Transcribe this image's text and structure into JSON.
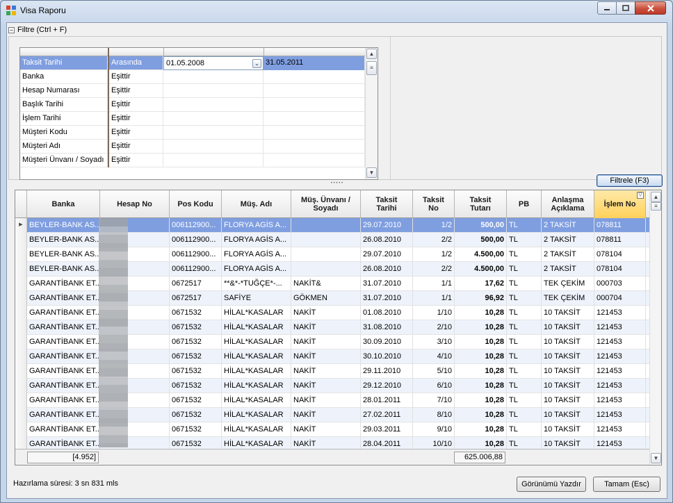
{
  "window": {
    "title": "Visa Raporu"
  },
  "filter": {
    "header": "Filtre (Ctrl + F)",
    "rows": [
      {
        "field": "Taksit Tarihi",
        "op": "Arasında",
        "v1": "01.05.2008",
        "v2": "31.05.2011"
      },
      {
        "field": "Banka",
        "op": "Eşittir",
        "v1": "",
        "v2": ""
      },
      {
        "field": "Hesap Numarası",
        "op": "Eşittir",
        "v1": "",
        "v2": ""
      },
      {
        "field": "Başlık Tarihi",
        "op": "Eşittir",
        "v1": "",
        "v2": ""
      },
      {
        "field": "İşlem Tarihi",
        "op": "Eşittir",
        "v1": "",
        "v2": ""
      },
      {
        "field": "Müşteri Kodu",
        "op": "Eşittir",
        "v1": "",
        "v2": ""
      },
      {
        "field": "Müşteri Adı",
        "op": "Eşittir",
        "v1": "",
        "v2": ""
      },
      {
        "field": "Müşteri Ünvanı / Soyadı",
        "op": "Eşittir",
        "v1": "",
        "v2": ""
      }
    ],
    "apply_button": "Filtrele (F3)"
  },
  "grid": {
    "columns": [
      {
        "label": "Banka"
      },
      {
        "label": "Hesap No"
      },
      {
        "label": "Pos Kodu"
      },
      {
        "label": "Müş. Adı"
      },
      {
        "label": "Müş. Ünvanı / Soyadı"
      },
      {
        "label": "Taksit Tarihi"
      },
      {
        "label": "Taksit No"
      },
      {
        "label": "Taksit Tutarı"
      },
      {
        "label": "PB"
      },
      {
        "label": "Anlaşma Açıklama"
      },
      {
        "label": "İşlem No"
      }
    ],
    "rows": [
      [
        "BEYLER-BANK AS...",
        "",
        "006112900...",
        "FLORYA AGİS A...",
        "",
        "29.07.2010",
        "1/2",
        "500,00",
        "TL",
        "2 TAKSİT",
        "078811"
      ],
      [
        "BEYLER-BANK AS...",
        "",
        "006112900...",
        "FLORYA AGİS A...",
        "",
        "26.08.2010",
        "2/2",
        "500,00",
        "TL",
        "2 TAKSİT",
        "078811"
      ],
      [
        "BEYLER-BANK AS...",
        "",
        "006112900...",
        "FLORYA AGİS A...",
        "",
        "29.07.2010",
        "1/2",
        "4.500,00",
        "TL",
        "2 TAKSİT",
        "078104"
      ],
      [
        "BEYLER-BANK AS...",
        "",
        "006112900...",
        "FLORYA AGİS A...",
        "",
        "26.08.2010",
        "2/2",
        "4.500,00",
        "TL",
        "2 TAKSİT",
        "078104"
      ],
      [
        "GARANTİBANK ET...",
        "",
        "0672517",
        "**&*-*TUĞÇE*-...",
        "NAKİT&",
        "31.07.2010",
        "1/1",
        "17,62",
        "TL",
        "TEK ÇEKİM",
        "000703"
      ],
      [
        "GARANTİBANK ET...",
        "",
        "0672517",
        "SAFİYE",
        "GÖKMEN",
        "31.07.2010",
        "1/1",
        "96,92",
        "TL",
        "TEK ÇEKİM",
        "000704"
      ],
      [
        "GARANTİBANK ET...",
        "",
        "0671532",
        "HİLAL*KASALAR",
        "NAKİT",
        "01.08.2010",
        "1/10",
        "10,28",
        "TL",
        "10 TAKSİT",
        "121453"
      ],
      [
        "GARANTİBANK ET...",
        "",
        "0671532",
        "HİLAL*KASALAR",
        "NAKİT",
        "31.08.2010",
        "2/10",
        "10,28",
        "TL",
        "10 TAKSİT",
        "121453"
      ],
      [
        "GARANTİBANK ET...",
        "",
        "0671532",
        "HİLAL*KASALAR",
        "NAKİT",
        "30.09.2010",
        "3/10",
        "10,28",
        "TL",
        "10 TAKSİT",
        "121453"
      ],
      [
        "GARANTİBANK ET...",
        "",
        "0671532",
        "HİLAL*KASALAR",
        "NAKİT",
        "30.10.2010",
        "4/10",
        "10,28",
        "TL",
        "10 TAKSİT",
        "121453"
      ],
      [
        "GARANTİBANK ET...",
        "",
        "0671532",
        "HİLAL*KASALAR",
        "NAKİT",
        "29.11.2010",
        "5/10",
        "10,28",
        "TL",
        "10 TAKSİT",
        "121453"
      ],
      [
        "GARANTİBANK ET...",
        "",
        "0671532",
        "HİLAL*KASALAR",
        "NAKİT",
        "29.12.2010",
        "6/10",
        "10,28",
        "TL",
        "10 TAKSİT",
        "121453"
      ],
      [
        "GARANTİBANK ET...",
        "",
        "0671532",
        "HİLAL*KASALAR",
        "NAKİT",
        "28.01.2011",
        "7/10",
        "10,28",
        "TL",
        "10 TAKSİT",
        "121453"
      ],
      [
        "GARANTİBANK ET...",
        "",
        "0671532",
        "HİLAL*KASALAR",
        "NAKİT",
        "27.02.2011",
        "8/10",
        "10,28",
        "TL",
        "10 TAKSİT",
        "121453"
      ],
      [
        "GARANTİBANK ET...",
        "",
        "0671532",
        "HİLAL*KASALAR",
        "NAKİT",
        "29.03.2011",
        "9/10",
        "10,28",
        "TL",
        "10 TAKSİT",
        "121453"
      ],
      [
        "GARANTİBANK ET...",
        "",
        "0671532",
        "HİLAL*KASALAR",
        "NAKİT",
        "28.04.2011",
        "10/10",
        "10,28",
        "TL",
        "10 TAKSİT",
        "121453"
      ]
    ],
    "selected_row": 0,
    "footer": {
      "count": "[4.952]",
      "total": "625.006,88"
    }
  },
  "status": {
    "label": "Hazırlama süresi: 3 sn 831 mls"
  },
  "buttons": {
    "print": "Görünümü Yazdır",
    "ok": "Tamam (Esc)"
  },
  "colors": {
    "selection": "#7f9ee0",
    "sorted_header": "#ffd15a",
    "close_button": "#c9503c"
  }
}
